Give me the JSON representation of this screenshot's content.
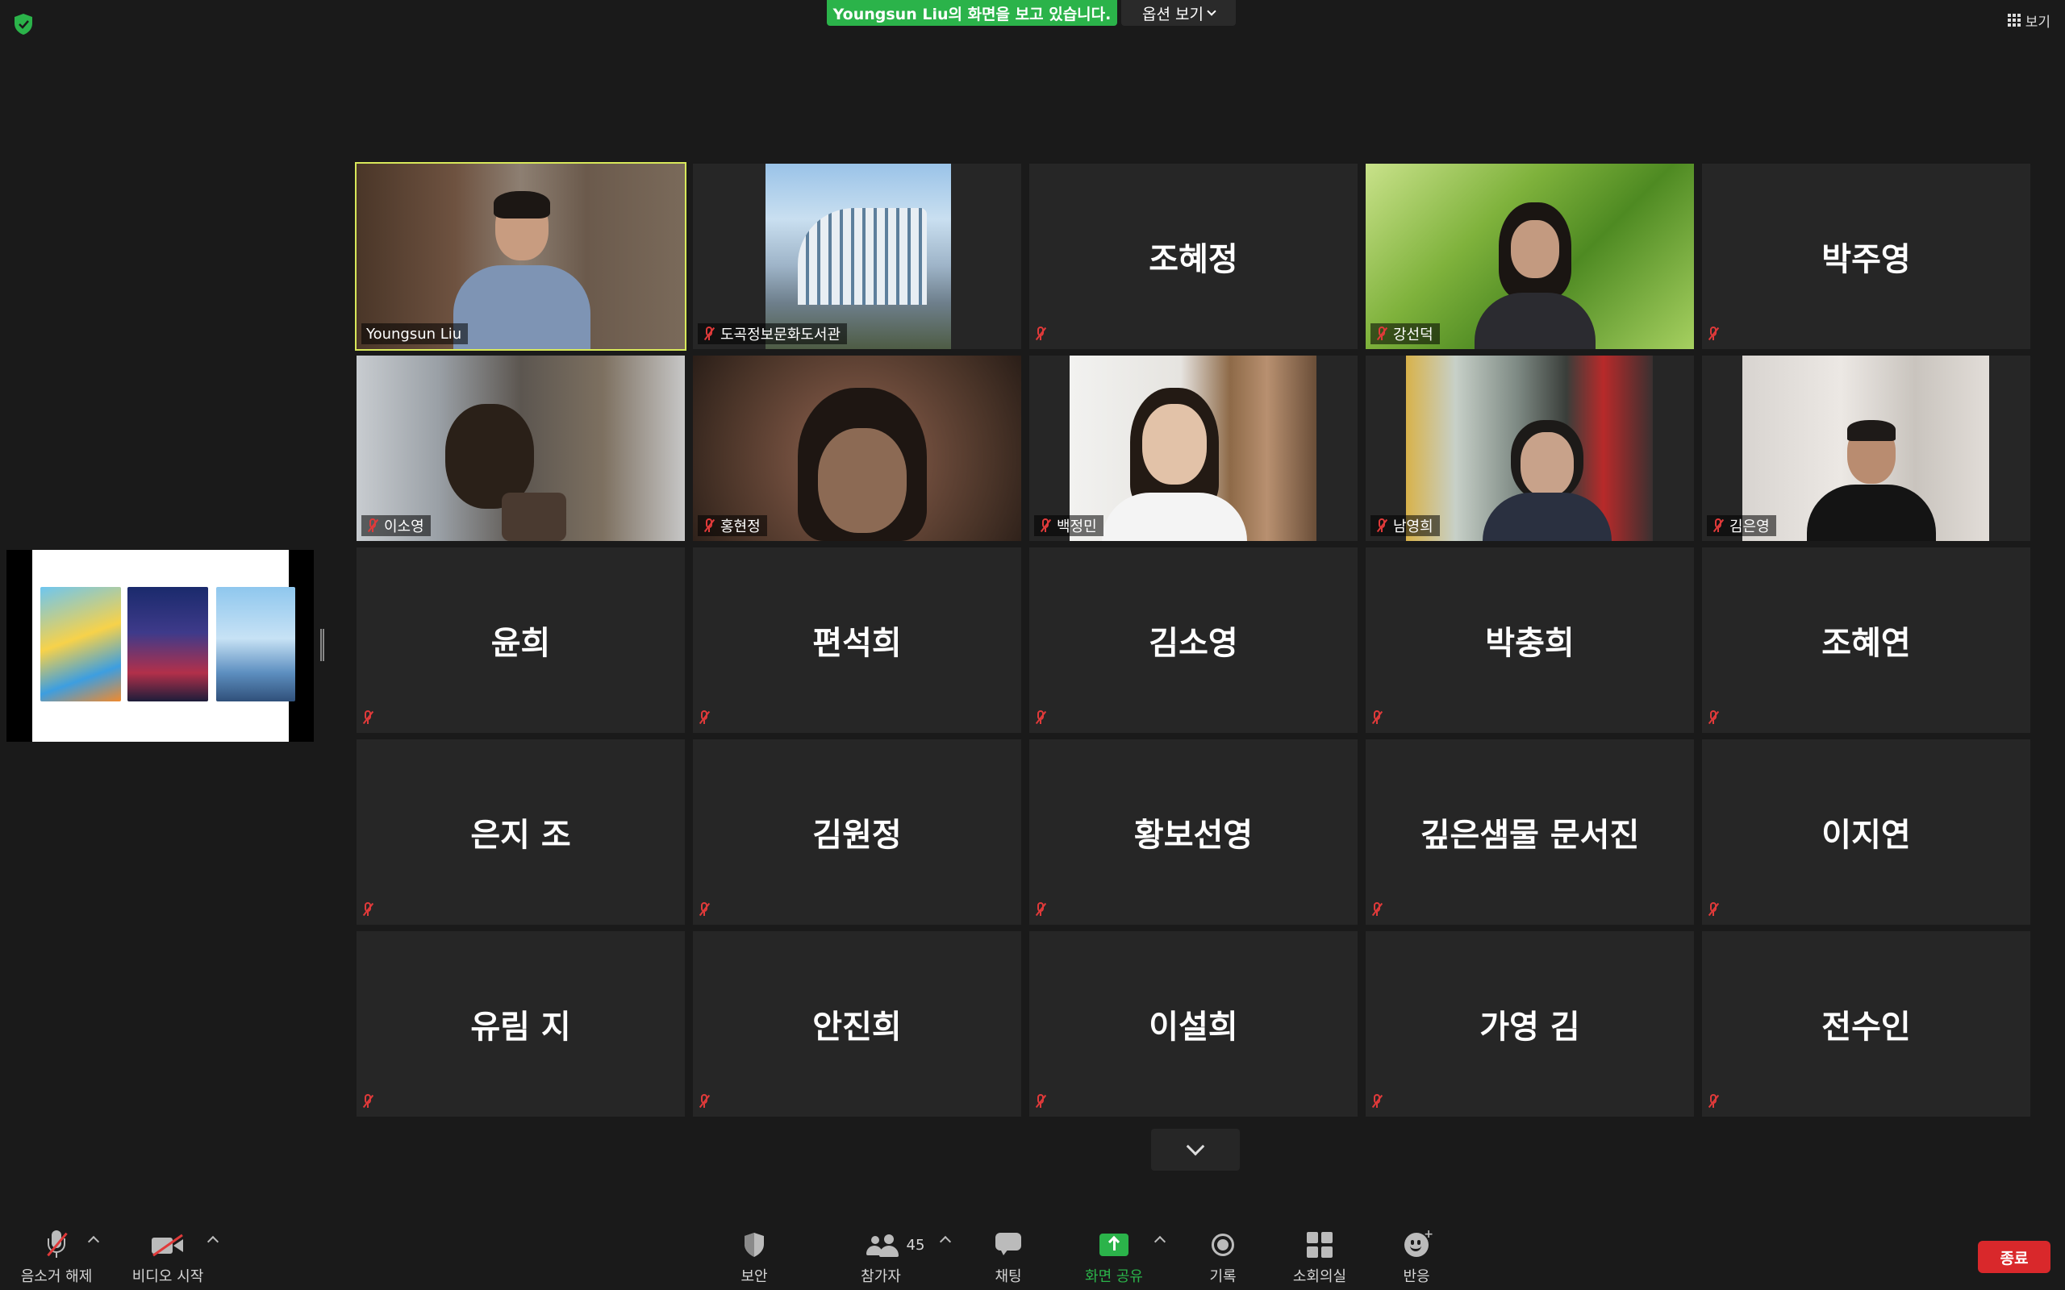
{
  "top": {
    "share_banner": "Youngsun Liu의 화면을 보고 있습니다.",
    "options_label": "옵션 보기",
    "view_label": "보기"
  },
  "tiles": [
    {
      "name": "Youngsun Liu",
      "mode": "video",
      "muted": false,
      "active": true
    },
    {
      "name": "도곡정보문화도서관",
      "mode": "video",
      "muted": true
    },
    {
      "name": "조혜정",
      "mode": "name",
      "muted": true
    },
    {
      "name": "강선덕",
      "mode": "video",
      "muted": true
    },
    {
      "name": "박주영",
      "mode": "name",
      "muted": true
    },
    {
      "name": "이소영",
      "mode": "video",
      "muted": true
    },
    {
      "name": "홍현정",
      "mode": "video",
      "muted": true
    },
    {
      "name": "백정민",
      "mode": "video",
      "muted": true
    },
    {
      "name": "남영희",
      "mode": "video",
      "muted": true
    },
    {
      "name": "김은영",
      "mode": "video",
      "muted": true
    },
    {
      "name": "윤희",
      "mode": "name",
      "muted": true
    },
    {
      "name": "편석희",
      "mode": "name",
      "muted": true
    },
    {
      "name": "김소영",
      "mode": "name",
      "muted": true
    },
    {
      "name": "박충희",
      "mode": "name",
      "muted": true
    },
    {
      "name": "조혜연",
      "mode": "name",
      "muted": true
    },
    {
      "name": "은지 조",
      "mode": "name",
      "muted": true
    },
    {
      "name": "김원정",
      "mode": "name",
      "muted": true
    },
    {
      "name": "황보선영",
      "mode": "name",
      "muted": true
    },
    {
      "name": "깊은샘물 문서진",
      "mode": "name",
      "muted": true
    },
    {
      "name": "이지연",
      "mode": "name",
      "muted": true
    },
    {
      "name": "유림 지",
      "mode": "name",
      "muted": true
    },
    {
      "name": "안진희",
      "mode": "name",
      "muted": true
    },
    {
      "name": "이설희",
      "mode": "name",
      "muted": true
    },
    {
      "name": "가영 김",
      "mode": "name",
      "muted": true
    },
    {
      "name": "전수인",
      "mode": "name",
      "muted": true
    }
  ],
  "toolbar": {
    "unmute_label": "음소거 해제",
    "video_label": "비디오 시작",
    "security_label": "보안",
    "participants_label": "참가자",
    "participants_count": "45",
    "chat_label": "채팅",
    "share_label": "화면 공유",
    "record_label": "기록",
    "rooms_label": "소회의실",
    "reactions_label": "반응",
    "end_label": "종료"
  },
  "colors": {
    "accent_green": "#2bb34a",
    "end_red": "#d9282b",
    "active_speaker": "#d8e85a",
    "mute_red": "#e03a3a"
  }
}
